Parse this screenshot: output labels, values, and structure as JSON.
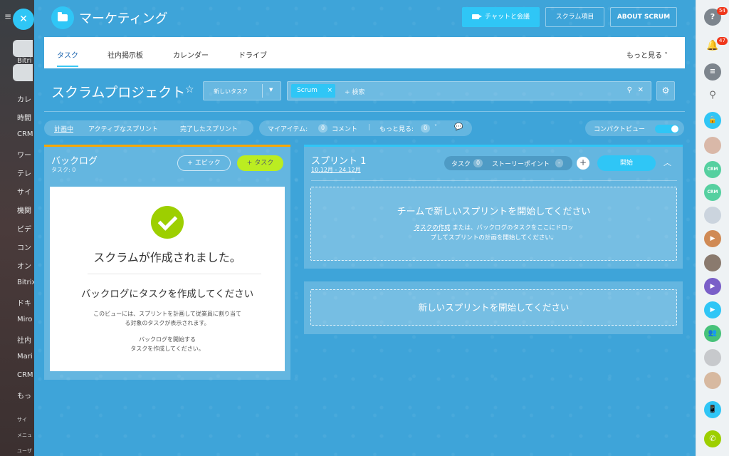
{
  "left_sidebar": {
    "items": [
      "Bitri",
      "カレ",
      "時間",
      "CRM",
      "ワー",
      "テレ",
      "サイ",
      "機関",
      "ビデ",
      "コン",
      "オン",
      "Bitrix",
      "ドキ",
      "Miro",
      "社内",
      "Mari",
      "CRM",
      "もっ"
    ],
    "footer": [
      "サイ",
      "メニュ",
      "ユーザ"
    ]
  },
  "header": {
    "title": "マーケティング",
    "chat_button": "チャットと会議",
    "scrum_items_button": "スクラム項目",
    "about_button": "ABOUT SCRUM"
  },
  "tabs": {
    "items": [
      "タスク",
      "社内掲示板",
      "カレンダー",
      "ドライブ"
    ],
    "more": "もっと見る ˅"
  },
  "toolbar": {
    "page_title": "スクラムプロジェクト",
    "new_task": "新しいタスク",
    "filter_chip": "Scrum",
    "search_placeholder": "+ 検索"
  },
  "filters": {
    "planning": "計画中",
    "active_sprint": "アクティブなスプリント",
    "completed_sprint": "完了したスプリント",
    "my_items": "マイアイテム:",
    "my_items_count": "0",
    "comments": "コメント",
    "more": "もっと見る:",
    "more_count": "0",
    "compact_view": "コンパクトビュー"
  },
  "backlog": {
    "title": "バックログ",
    "count": "タスク: 0",
    "epic_button": "+ エピック",
    "task_button": "+ タスク",
    "heading": "スクラムが作成されました。",
    "subheading": "バックログにタスクを作成してください",
    "desc1": "このビューには、スプリントを計画して従業員に割り当て",
    "desc2": "る対象のタスクが表示されます。",
    "desc3": "バックログを開始する",
    "desc4": "タスクを作成してください。"
  },
  "sprint": {
    "title": "スプリント 1",
    "dates": "10.12月 - 24.12月",
    "tasks_label": "タスク",
    "tasks_count": "0",
    "story_points_label": "ストーリーポイント",
    "story_points_value": "-",
    "start_button": "開始",
    "drop_heading": "チームで新しいスプリントを開始してください",
    "drop_link": "タスクの作成",
    "drop_text1": " または、バックログのタスクをここにドロッ",
    "drop_text2": "プしてスプリントの計画を開始してください。"
  },
  "new_sprint": {
    "label": "新しいスプリントを開始してください"
  },
  "right_sidebar": {
    "badge_help": "54",
    "badge_notifications": "47",
    "crm_label": "CRM"
  },
  "colors": {
    "panel_bg": "#3ea4d9",
    "accent": "#2fc6f6",
    "task_green": "#bbed21",
    "backlog_bar": "#f7a700"
  }
}
